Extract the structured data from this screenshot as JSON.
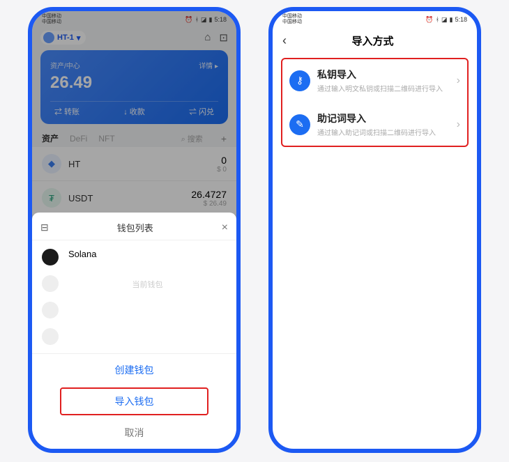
{
  "status": {
    "carrier": "中国移动",
    "time": "5:18",
    "icons": "✆ ⧉ ⚡47"
  },
  "left": {
    "network_pill": "HT-1",
    "balance_label": "资产/中心",
    "balance_caret": "详情 ▸",
    "balance": "26.49",
    "actions": {
      "transfer": "⇄ 转账",
      "receive": "↓ 收款",
      "swap": "⇌ 闪兑"
    },
    "tabs": {
      "assets": "资产",
      "defi": "DeFi",
      "nft": "NFT",
      "search": "⌕ 搜索",
      "add": "+"
    },
    "tokens": [
      {
        "symbol": "HT",
        "amount": "0",
        "sub": "$ 0",
        "color": "#3b7ff0"
      },
      {
        "symbol": "USDT",
        "amount": "26.4727",
        "sub": "$ 26.49",
        "color": "#26a17b"
      }
    ],
    "sheet": {
      "title": "钱包列表",
      "wallet_name": "Solana",
      "placeholder": "当前钱包",
      "create": "创建钱包",
      "import": "导入钱包",
      "cancel": "取消"
    }
  },
  "right": {
    "title": "导入方式",
    "options": [
      {
        "title": "私钥导入",
        "desc": "通过输入明文私钥或扫描二维码进行导入",
        "icon_color": "#1c6df2",
        "glyph": "⚷"
      },
      {
        "title": "助记词导入",
        "desc": "通过输入助记词或扫描二维码进行导入",
        "icon_color": "#1c6df2",
        "glyph": "✎"
      }
    ]
  }
}
